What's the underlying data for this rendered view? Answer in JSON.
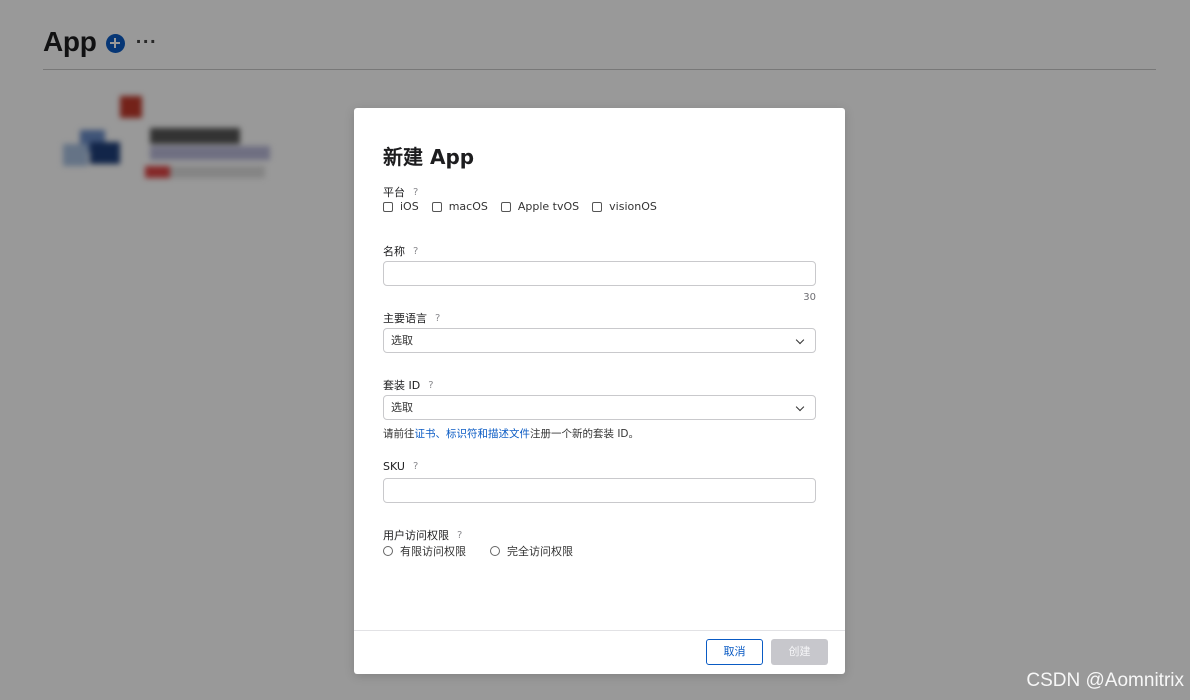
{
  "page": {
    "title": "App",
    "more_label": "···"
  },
  "modal": {
    "title": "新建 App",
    "help_glyph": "?",
    "platform": {
      "label": "平台",
      "options": [
        "iOS",
        "macOS",
        "Apple tvOS",
        "visionOS"
      ]
    },
    "name": {
      "label": "名称",
      "value": "",
      "remaining": "30"
    },
    "primary_language": {
      "label": "主要语言",
      "selected": "选取"
    },
    "bundle_id": {
      "label": "套装 ID",
      "selected": "选取",
      "hint_before": "请前往",
      "hint_link": "证书、标识符和描述文件",
      "hint_after": "注册一个新的套装 ID。"
    },
    "sku": {
      "label": "SKU",
      "value": ""
    },
    "user_access": {
      "label": "用户访问权限",
      "options": [
        "有限访问权限",
        "完全访问权限"
      ]
    },
    "cancel_label": "取消",
    "create_label": "创建"
  },
  "watermark": "CSDN @Aomnitrix",
  "colors": {
    "accent": "#0a5bc4",
    "disabled_button": "#c7c7cc",
    "overlay": "rgba(0,0,0,0.40)"
  }
}
